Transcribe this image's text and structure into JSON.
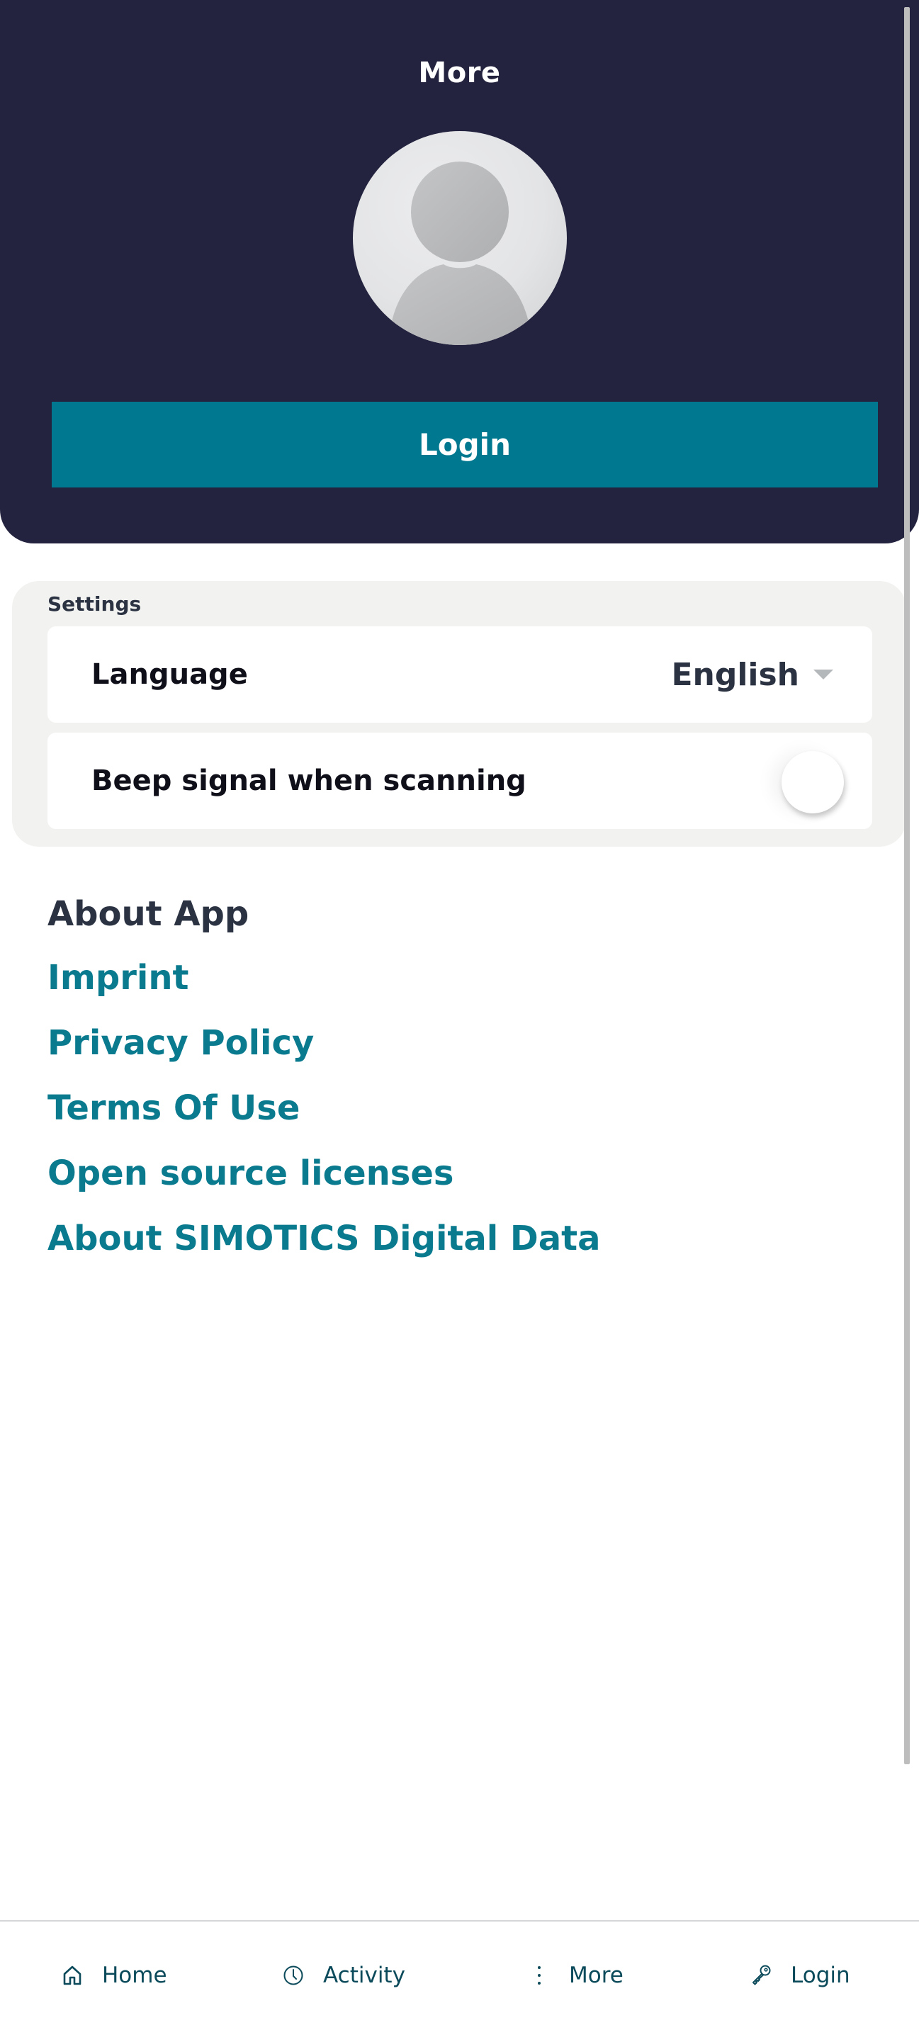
{
  "header": {
    "title": "More",
    "avatar_icon": "user-placeholder-icon",
    "login_button_label": "Login"
  },
  "settings": {
    "section_label": "Settings",
    "language": {
      "label": "Language",
      "value": "English",
      "icon": "caret-down-icon"
    },
    "beep": {
      "label": "Beep signal when scanning",
      "enabled": false
    }
  },
  "about": {
    "heading": "About App",
    "links": [
      {
        "label": "Imprint"
      },
      {
        "label": "Privacy Policy"
      },
      {
        "label": "Terms Of Use"
      },
      {
        "label": "Open source licenses"
      },
      {
        "label": "About SIMOTICS Digital Data"
      }
    ]
  },
  "bottom_nav": {
    "items": [
      {
        "label": "Home",
        "icon": "home-icon"
      },
      {
        "label": "Activity",
        "icon": "clock-icon"
      },
      {
        "label": "More",
        "icon": "more-vertical-icon"
      },
      {
        "label": "Login",
        "icon": "key-icon"
      }
    ]
  },
  "colors": {
    "header_bg": "#23233f",
    "accent": "#007890",
    "link": "#0a7a8f",
    "nav_text": "#0b4a5a"
  }
}
